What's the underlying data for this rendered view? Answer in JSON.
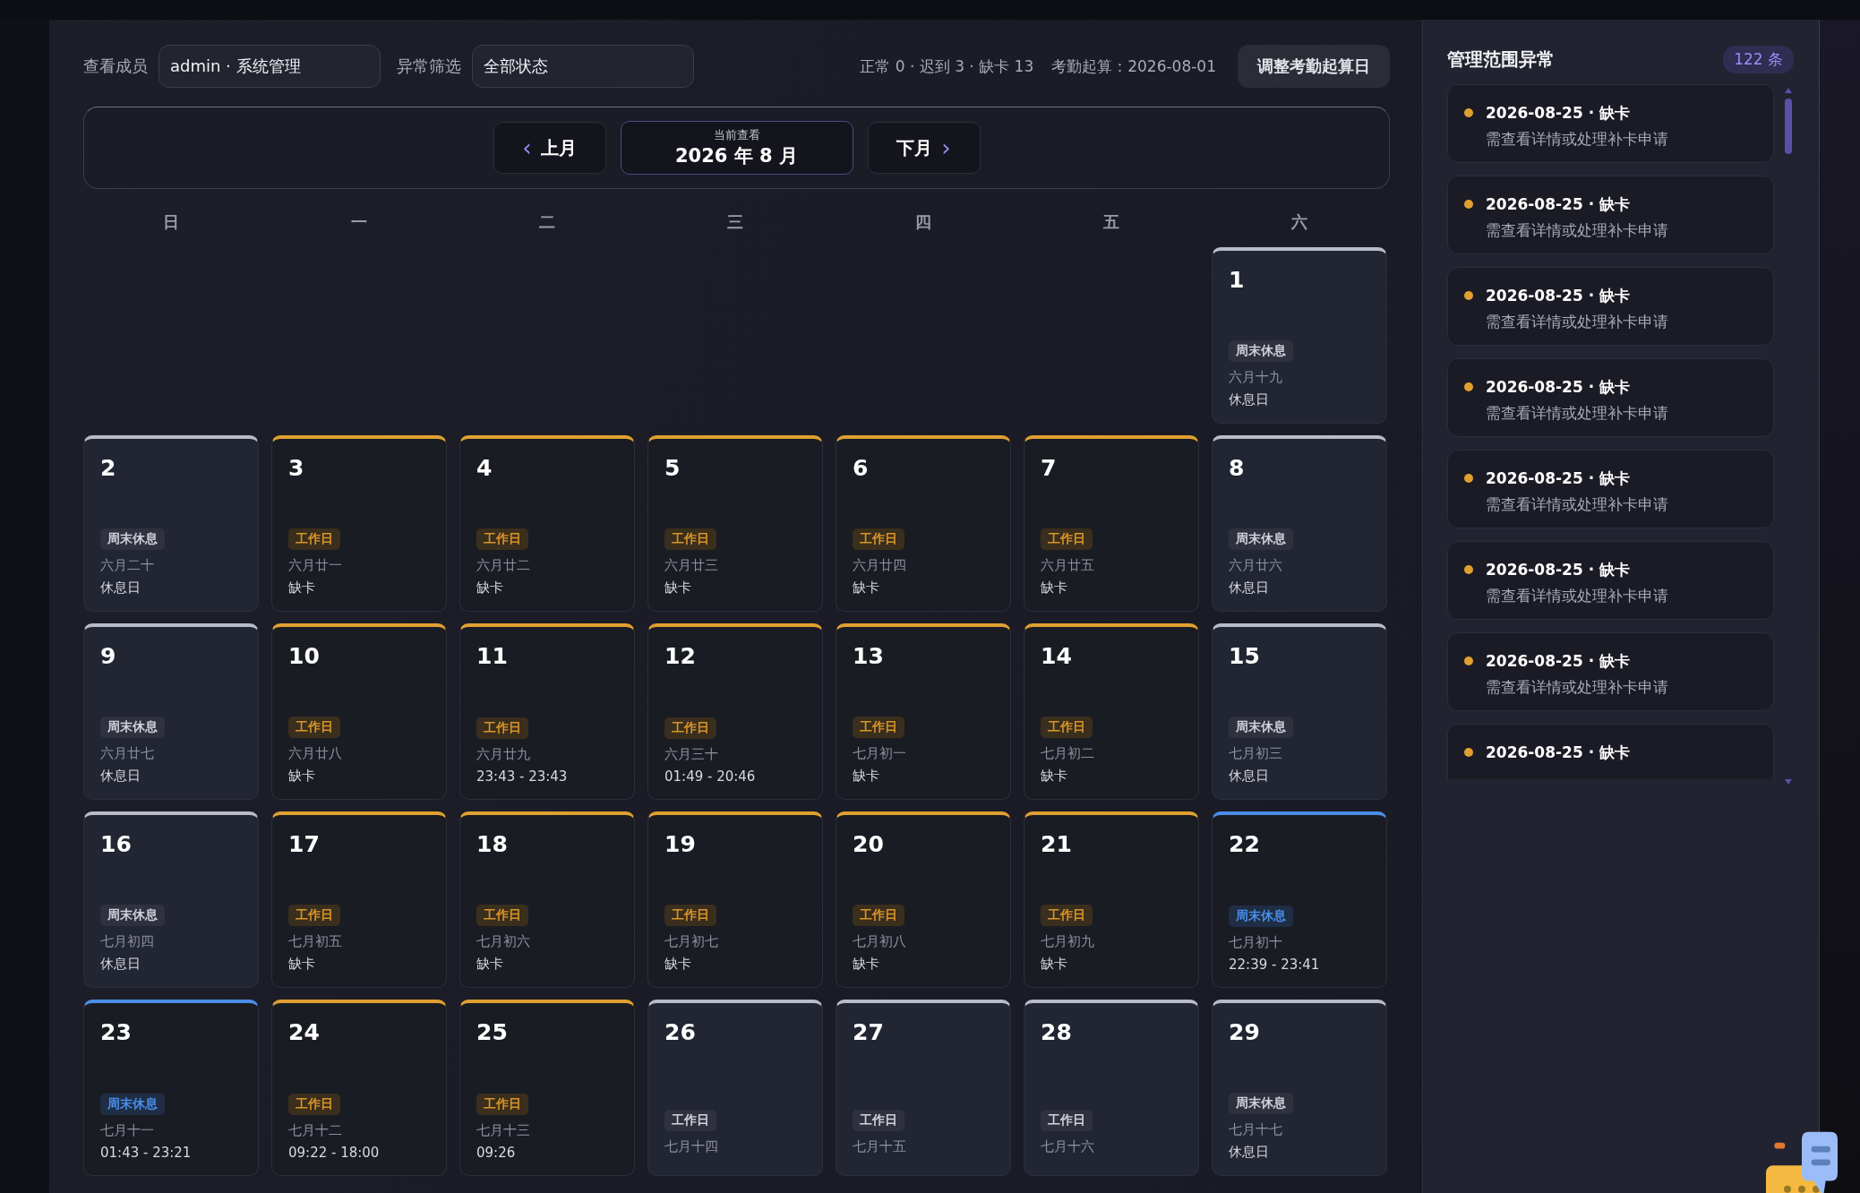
{
  "filters": [
    {
      "label": "查看成员",
      "value": "admin · 系统管理"
    },
    {
      "label": "异常筛选",
      "value": "全部状态"
    }
  ],
  "summary": "正常 0 · 迟到 3 · 缺卡 13",
  "period_start": "考勤起算：2026-08-01",
  "adjust_button": "调整考勤起算日",
  "nav": {
    "prev": "上月",
    "prev_icon": "‹",
    "caption": "当前查看",
    "current": "2026 年 8 月",
    "next": "下月",
    "next_icon": "›"
  },
  "weekdays": [
    "日",
    "一",
    "二",
    "三",
    "四",
    "五",
    "六"
  ],
  "weeks": [
    [
      {
        "day": "1",
        "kind": "weekend",
        "tag": "周末休息",
        "lunar": "六月十九",
        "note": "休息日"
      }
    ],
    [
      {
        "day": "2",
        "kind": "weekend",
        "tag": "周末休息",
        "lunar": "六月二十",
        "note": "休息日"
      },
      {
        "day": "3",
        "kind": "workday",
        "tag": "工作日",
        "lunar": "六月廿一",
        "note": "缺卡"
      },
      {
        "day": "4",
        "kind": "workday",
        "tag": "工作日",
        "lunar": "六月廿二",
        "note": "缺卡"
      },
      {
        "day": "5",
        "kind": "workday",
        "tag": "工作日",
        "lunar": "六月廿三",
        "note": "缺卡"
      },
      {
        "day": "6",
        "kind": "workday",
        "tag": "工作日",
        "lunar": "六月廿四",
        "note": "缺卡"
      },
      {
        "day": "7",
        "kind": "workday",
        "tag": "工作日",
        "lunar": "六月廿五",
        "note": "缺卡"
      },
      {
        "day": "8",
        "kind": "weekend",
        "tag": "周末休息",
        "lunar": "六月廿六",
        "note": "休息日"
      }
    ],
    [
      {
        "day": "9",
        "kind": "weekend",
        "tag": "周末休息",
        "lunar": "六月廿七",
        "note": "休息日"
      },
      {
        "day": "10",
        "kind": "workday",
        "tag": "工作日",
        "lunar": "六月廿八",
        "note": "缺卡"
      },
      {
        "day": "11",
        "kind": "workday",
        "tag": "工作日",
        "lunar": "六月廿九",
        "note": "23:43 - 23:43"
      },
      {
        "day": "12",
        "kind": "workday",
        "tag": "工作日",
        "lunar": "六月三十",
        "note": "01:49 - 20:46"
      },
      {
        "day": "13",
        "kind": "workday",
        "tag": "工作日",
        "lunar": "七月初一",
        "note": "缺卡"
      },
      {
        "day": "14",
        "kind": "workday",
        "tag": "工作日",
        "lunar": "七月初二",
        "note": "缺卡"
      },
      {
        "day": "15",
        "kind": "weekend",
        "tag": "周末休息",
        "lunar": "七月初三",
        "note": "休息日"
      }
    ],
    [
      {
        "day": "16",
        "kind": "weekend",
        "tag": "周末休息",
        "lunar": "七月初四",
        "note": "休息日"
      },
      {
        "day": "17",
        "kind": "workday",
        "tag": "工作日",
        "lunar": "七月初五",
        "note": "缺卡"
      },
      {
        "day": "18",
        "kind": "workday",
        "tag": "工作日",
        "lunar": "七月初六",
        "note": "缺卡"
      },
      {
        "day": "19",
        "kind": "workday",
        "tag": "工作日",
        "lunar": "七月初七",
        "note": "缺卡"
      },
      {
        "day": "20",
        "kind": "workday",
        "tag": "工作日",
        "lunar": "七月初八",
        "note": "缺卡"
      },
      {
        "day": "21",
        "kind": "workday",
        "tag": "工作日",
        "lunar": "七月初九",
        "note": "缺卡"
      },
      {
        "day": "22",
        "kind": "weekend_punched",
        "tag": "周末休息",
        "lunar": "七月初十",
        "note": "22:39 - 23:41"
      }
    ],
    [
      {
        "day": "23",
        "kind": "weekend_punched",
        "tag": "周末休息",
        "lunar": "七月十一",
        "note": "01:43 - 23:21"
      },
      {
        "day": "24",
        "kind": "workday",
        "tag": "工作日",
        "lunar": "七月十二",
        "note": "09:22 - 18:00"
      },
      {
        "day": "25",
        "kind": "workday",
        "tag": "工作日",
        "lunar": "七月十三",
        "note": "09:26"
      },
      {
        "day": "26",
        "kind": "upcoming",
        "tag": "工作日",
        "lunar": "七月十四"
      },
      {
        "day": "27",
        "kind": "upcoming",
        "tag": "工作日",
        "lunar": "七月十五"
      },
      {
        "day": "28",
        "kind": "upcoming",
        "tag": "工作日",
        "lunar": "七月十六"
      },
      {
        "day": "29",
        "kind": "weekend",
        "tag": "周末休息",
        "lunar": "七月十七",
        "note": "休息日"
      }
    ]
  ],
  "sidebar": {
    "title": "管理范围异常",
    "count": "122 条",
    "items": [
      {
        "title": "2026-08-25 · 缺卡",
        "detail": "需查看详情或处理补卡申请",
        "color": "#e0a030"
      },
      {
        "title": "2026-08-25 · 缺卡",
        "detail": "需查看详情或处理补卡申请",
        "color": "#e0a030"
      },
      {
        "title": "2026-08-25 · 缺卡",
        "detail": "需查看详情或处理补卡申请",
        "color": "#e0a030"
      },
      {
        "title": "2026-08-25 · 缺卡",
        "detail": "需查看详情或处理补卡申请",
        "color": "#e0a030"
      },
      {
        "title": "2026-08-25 · 缺卡",
        "detail": "需查看详情或处理补卡申请",
        "color": "#e0a030"
      },
      {
        "title": "2026-08-25 · 缺卡",
        "detail": "需查看详情或处理补卡申请",
        "color": "#e0a030"
      },
      {
        "title": "2026-08-25 · 缺卡",
        "detail": "需查看详情或处理补卡申请",
        "color": "#e0a030"
      },
      {
        "title": "2026-08-25 · 缺卡",
        "color": "#e0a030"
      }
    ]
  }
}
